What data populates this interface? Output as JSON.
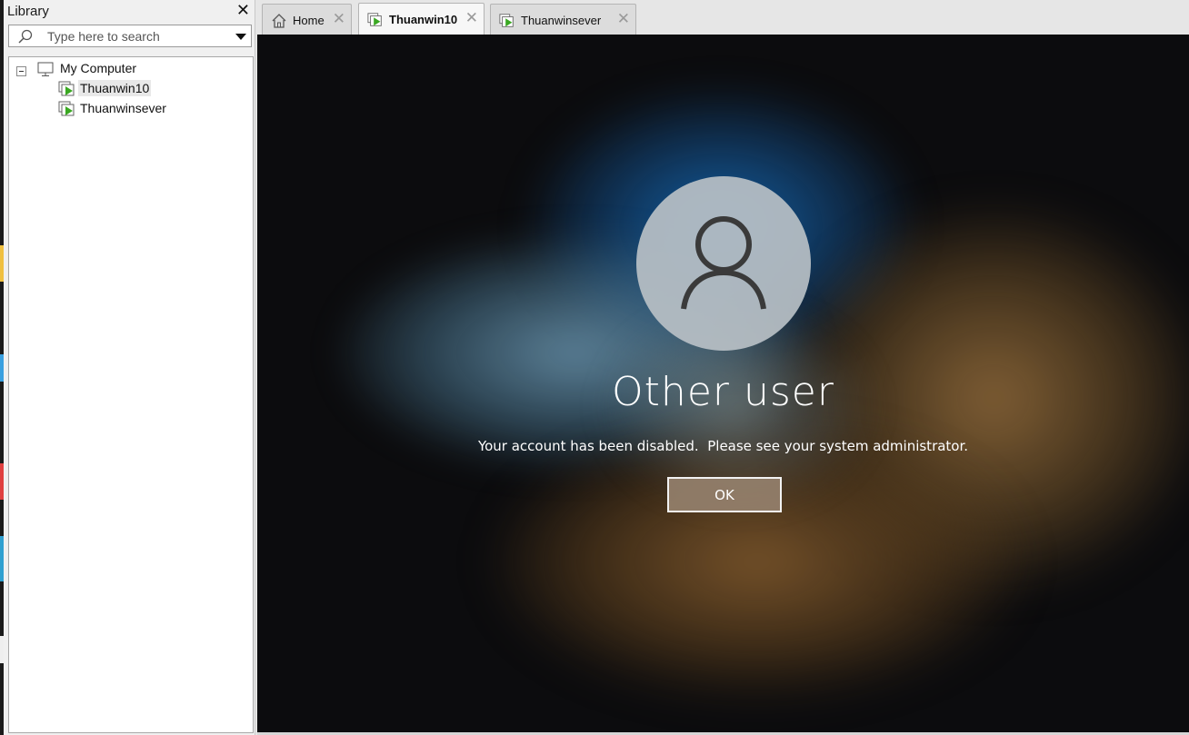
{
  "library": {
    "title": "Library",
    "close_icon": "close-icon",
    "search": {
      "placeholder": "Type here to search",
      "value": ""
    },
    "tree": {
      "root": {
        "label": "My Computer",
        "icon": "computer-icon",
        "expanded": true
      },
      "items": [
        {
          "label": "Thuanwin10",
          "icon": "vm-running-icon",
          "selected": true
        },
        {
          "label": "Thuanwinsever",
          "icon": "vm-running-icon",
          "selected": false
        }
      ]
    }
  },
  "tabs": [
    {
      "label": "Home",
      "icon": "home-icon",
      "active": false
    },
    {
      "label": "Thuanwin10",
      "icon": "vm-running-icon",
      "active": true
    },
    {
      "label": "Thuanwinsever",
      "icon": "vm-running-icon",
      "active": false
    }
  ],
  "vm_screen": {
    "user_icon": "user-avatar-icon",
    "username": "Other user",
    "message": "Your account has been disabled.  Please see your system administrator.",
    "ok_label": "OK"
  },
  "colors": {
    "vm_icon_green": "#3aa822",
    "selection_bg": "#e8e8e8"
  }
}
